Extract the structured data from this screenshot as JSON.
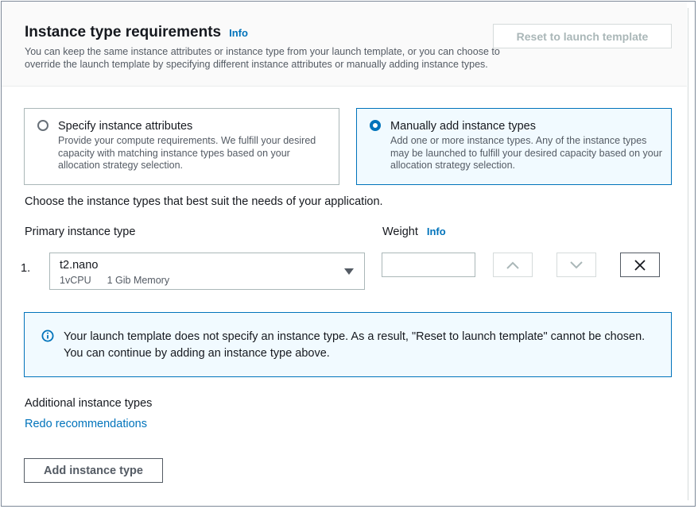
{
  "header": {
    "title": "Instance type requirements",
    "info_label": "Info",
    "description": "You can keep the same instance attributes or instance type from your launch template, or you can choose to override the launch template by specifying different instance attributes or manually adding instance types.",
    "reset_button": "Reset to launch template"
  },
  "options": [
    {
      "title": "Specify instance attributes",
      "description": "Provide your compute requirements. We fulfill your desired capacity with matching instance types based on your allocation strategy selection.",
      "selected": false
    },
    {
      "title": "Manually add instance types",
      "description": "Add one or more instance types. Any of the instance types may be launched to fulfill your desired capacity based on your allocation strategy selection.",
      "selected": true
    }
  ],
  "choose_text": "Choose the instance types that best suit the needs of your application.",
  "primary": {
    "label": "Primary instance type",
    "row_number": "1.",
    "selected_type": "t2.nano",
    "vcpu": "1vCPU",
    "memory": "1 Gib Memory",
    "weight_label": "Weight",
    "weight_info": "Info",
    "weight_value": ""
  },
  "alert": {
    "icon": "info-circle-icon",
    "text": "Your launch template does not specify an instance type. As a result, \"Reset to launch template\" cannot be chosen. You can continue by adding an instance type above."
  },
  "additional": {
    "label": "Additional instance types",
    "redo_link": "Redo recommendations",
    "add_button": "Add instance type"
  },
  "colors": {
    "accent": "#0073bb",
    "text": "#16191f",
    "muted": "#545b64",
    "border": "#aab7b8",
    "selected_bg": "#f1faff"
  }
}
